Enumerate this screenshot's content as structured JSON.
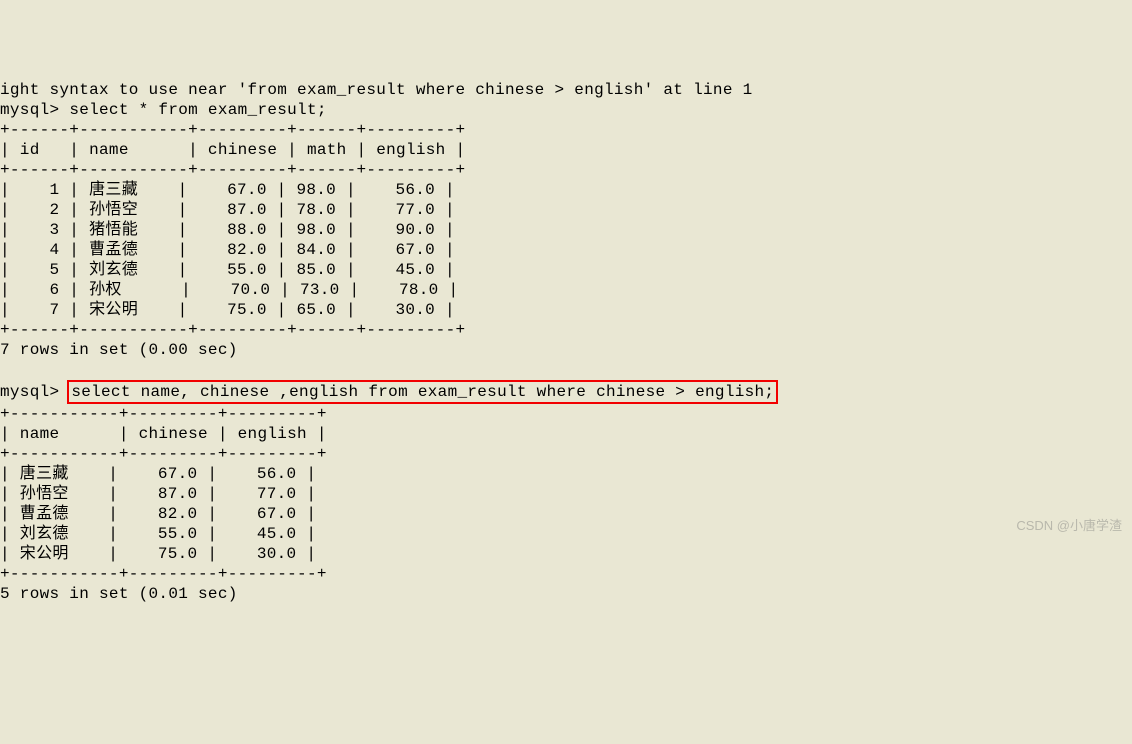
{
  "partial_line": "ight syntax to use near 'from exam_result where chinese > english' at line 1",
  "prompt1": "mysql> ",
  "query1": "select * from exam_result;",
  "table1_border_top": "+------+-----------+---------+------+---------+",
  "table1_header": "| id   | name      | chinese | math | english |",
  "table1_border_mid": "+------+-----------+---------+------+---------+",
  "table1_rows": [
    "|    1 | 唐三藏    |    67.0 | 98.0 |    56.0 |",
    "|    2 | 孙悟空    |    87.0 | 78.0 |    77.0 |",
    "|    3 | 猪悟能    |    88.0 | 98.0 |    90.0 |",
    "|    4 | 曹孟德    |    82.0 | 84.0 |    67.0 |",
    "|    5 | 刘玄德    |    55.0 | 85.0 |    45.0 |",
    "|    6 | 孙权      |    70.0 | 73.0 |    78.0 |",
    "|    7 | 宋公明    |    75.0 | 65.0 |    30.0 |"
  ],
  "table1_border_bot": "+------+-----------+---------+------+---------+",
  "result1": "7 rows in set (0.00 sec)",
  "prompt2": "mysql> ",
  "query2": "select name, chinese ,english from exam_result where chinese > english;",
  "table2_border_top": "+-----------+---------+---------+",
  "table2_header": "| name      | chinese | english |",
  "table2_border_mid": "+-----------+---------+---------+",
  "table2_rows": [
    "| 唐三藏    |    67.0 |    56.0 |",
    "| 孙悟空    |    87.0 |    77.0 |",
    "| 曹孟德    |    82.0 |    67.0 |",
    "| 刘玄德    |    55.0 |    45.0 |",
    "| 宋公明    |    75.0 |    30.0 |"
  ],
  "table2_border_bot": "+-----------+---------+---------+",
  "result2": "5 rows in set (0.01 sec)",
  "watermark": "CSDN @小唐学渣"
}
